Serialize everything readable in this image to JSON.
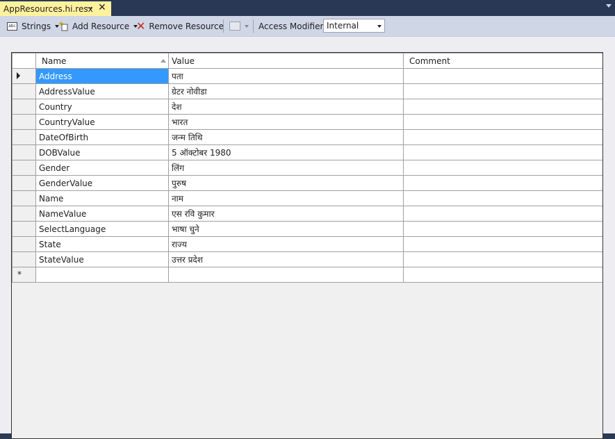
{
  "tab": {
    "title": "AppResources.hi.resx",
    "pin_glyph": "⊸",
    "close_glyph": "✕"
  },
  "toolbar": {
    "strings_label": "Strings",
    "add_resource_label": "Add Resource",
    "remove_resource_label": "Remove Resource",
    "access_modifier_label": "Access Modifier:",
    "access_modifier_value": "Internal"
  },
  "grid": {
    "columns": [
      "Name",
      "Value",
      "Comment"
    ],
    "rows": [
      {
        "name": "Address",
        "value": "पता",
        "comment": ""
      },
      {
        "name": "AddressValue",
        "value": "ग्रेटर नोवीडा",
        "comment": ""
      },
      {
        "name": "Country",
        "value": "देश",
        "comment": ""
      },
      {
        "name": "CountryValue",
        "value": "भारत",
        "comment": ""
      },
      {
        "name": "DateOfBirth",
        "value": "जन्म तिथि",
        "comment": ""
      },
      {
        "name": "DOBValue",
        "value": "5 ऑक्टोबर 1980",
        "comment": ""
      },
      {
        "name": "Gender",
        "value": "लिंग",
        "comment": ""
      },
      {
        "name": "GenderValue",
        "value": "पुरुष",
        "comment": ""
      },
      {
        "name": "Name",
        "value": "नाम",
        "comment": ""
      },
      {
        "name": "NameValue",
        "value": "एस रवि कुमार",
        "comment": ""
      },
      {
        "name": "SelectLanguage",
        "value": "भाषा चुने",
        "comment": ""
      },
      {
        "name": "State",
        "value": "राज्य",
        "comment": ""
      },
      {
        "name": "StateValue",
        "value": "उत्तर प्रदेश",
        "comment": ""
      }
    ],
    "new_row_marker": "*"
  },
  "colors": {
    "selection": "#3399ff",
    "tab_active": "#fff29d",
    "toolbar": "#cfd6e5",
    "remove_icon": "#c4271c"
  }
}
